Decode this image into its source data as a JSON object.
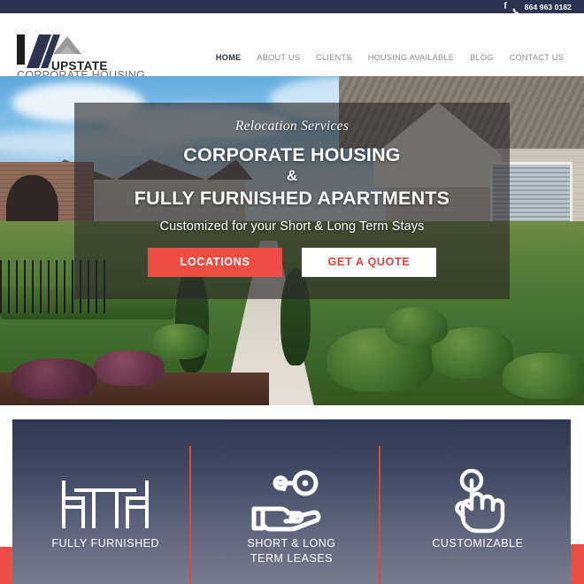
{
  "topbar": {
    "facebook_icon": "facebook-icon",
    "phone_icon": "phone-icon",
    "phone": "864 963 0182"
  },
  "header": {
    "logo": {
      "name": "UPSTATE",
      "tagline": "CORPORATE HOUSING"
    },
    "nav": [
      {
        "label": "HOME",
        "active": true
      },
      {
        "label": "ABOUT US",
        "active": false
      },
      {
        "label": "CLIENTS",
        "active": false
      },
      {
        "label": "HOUSING AVAILABLE",
        "active": false
      },
      {
        "label": "BLOG",
        "active": false
      },
      {
        "label": "CONTACT US",
        "active": false
      }
    ]
  },
  "hero": {
    "kicker": "Relocation Services",
    "title_line1": "CORPORATE HOUSING",
    "title_amp": "&",
    "title_line2": "FULLY FURNISHED APARTMENTS",
    "subtitle": "Customized for your Short & Long Term Stays",
    "buttons": [
      {
        "label": "LOCATIONS",
        "style": "primary"
      },
      {
        "label": "GET A QUOTE",
        "style": "secondary"
      }
    ]
  },
  "features": [
    {
      "icon": "table-and-chairs-icon",
      "label": "FULLY FURNISHED"
    },
    {
      "icon": "hand-holding-key-icon",
      "label": "SHORT & LONG\nTERM LEASES"
    },
    {
      "icon": "pointing-hand-icon",
      "label": "CUSTOMIZABLE"
    }
  ],
  "colors": {
    "navy": "#2b3450",
    "red": "#ec4e43",
    "panel_top": "#2f3850",
    "panel_bottom": "#757d8e",
    "nav_inactive": "#8c8c8c"
  }
}
